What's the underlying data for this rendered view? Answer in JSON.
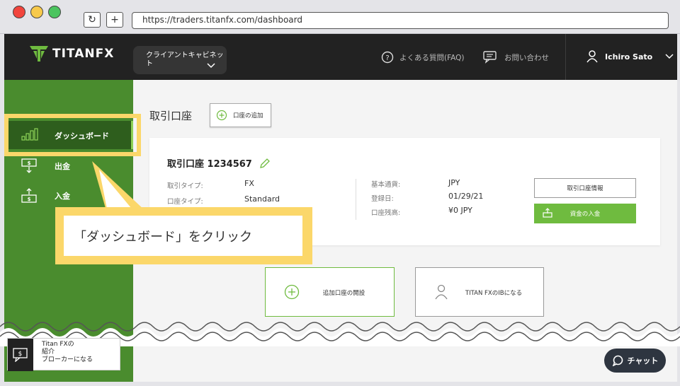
{
  "browser": {
    "url": "https://traders.titanfx.com/dashboard",
    "reload_glyph": "↻",
    "newtab_glyph": "+"
  },
  "header": {
    "logo_text": "TITANFX",
    "cabinet_label": "クライアントキャビネット",
    "faq_label": "よくある質問(FAQ)",
    "contact_label": "お問い合わせ",
    "user_name": "Ichiro Sato"
  },
  "sidebar": {
    "items": [
      {
        "label": "ダッシュボード",
        "icon": "bar-chart-icon"
      },
      {
        "label": "出金",
        "icon": "withdraw-icon"
      },
      {
        "label": "入金",
        "icon": "deposit-icon"
      }
    ]
  },
  "main": {
    "section_title": "取引口座",
    "add_account_label": "口座の追加",
    "account": {
      "title": "取引口座 1234567",
      "left": [
        {
          "label": "取引タイプ:",
          "value": "FX"
        },
        {
          "label": "口座タイプ:",
          "value": "Standard"
        }
      ],
      "right": [
        {
          "label": "基本通貨:",
          "value": "JPY"
        },
        {
          "label": "登録日:",
          "value": "01/29/21"
        },
        {
          "label": "口座残高:",
          "value": "¥0 JPY"
        }
      ],
      "info_button": "取引口座情報",
      "deposit_button": "資金の入金"
    },
    "open_additional_label": "追加口座の開設",
    "become_ib_label": "TITAN FXのIBになる"
  },
  "callout": {
    "text": "「ダッシュボード」をクリック"
  },
  "bottom": {
    "ib_card_lines": [
      "Titan FXの",
      "紹介",
      "ブローカーになる"
    ],
    "chat_label": "チャット"
  },
  "colors": {
    "sidebar_green": "#4a8c2e",
    "active_green": "#2e5e1d",
    "accent_green": "#6fbb3f",
    "highlight_yellow": "#fbd76a",
    "header_dark": "#222222"
  }
}
